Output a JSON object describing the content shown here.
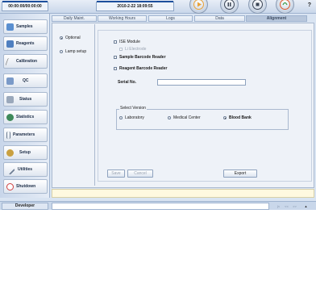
{
  "header": {
    "time_left": "00:00:00/00:00:00",
    "datetime": "2010-2-22 18:09:55",
    "help": "?"
  },
  "icons": {
    "run": "play-icon",
    "pause": "pause-icon",
    "stop": "stop-icon",
    "emergency": "emergency-icon"
  },
  "sidebar": {
    "items": [
      {
        "label": "Samples",
        "icon": "test-tube-icon",
        "color": "#5a8fd0"
      },
      {
        "label": "Reagents",
        "icon": "reagent-rack-icon",
        "color": "#4f7fc0"
      },
      {
        "label": "Calibration",
        "icon": "calibration-icon",
        "color": "#8c8c8c"
      },
      {
        "label": "QC",
        "icon": "qc-icon",
        "color": "#7a9ac8"
      },
      {
        "label": "Status",
        "icon": "status-icon",
        "color": "#9aa8bb"
      },
      {
        "label": "Statistics",
        "icon": "statistics-icon",
        "color": "#3f8a5a"
      },
      {
        "label": "Parameters",
        "icon": "parameters-icon",
        "color": "#6b7b8f"
      },
      {
        "label": "Setup",
        "icon": "setup-icon",
        "color": "#c9a040"
      },
      {
        "label": "Utilities",
        "icon": "utilities-icon",
        "color": "#6f7f95"
      },
      {
        "label": "Shutdown",
        "icon": "shutdown-icon",
        "color": "#d04040"
      }
    ]
  },
  "tabs": [
    {
      "label": "Daily Maint."
    },
    {
      "label": "Working Hours"
    },
    {
      "label": "Logs"
    },
    {
      "label": "Data"
    },
    {
      "label": "Alignment"
    }
  ],
  "left_options": {
    "optional": "Optional",
    "lamp_setup": "Lamp setup"
  },
  "options": {
    "ise_module": "ISE Module",
    "li_electrode": "Li Electrode",
    "sample_barcode": "Sample Barcode Reader",
    "reagent_barcode": "Reagent Barcode Reader",
    "serial_label": "Serial No.",
    "serial_value": ""
  },
  "version": {
    "title": "Select Version",
    "laboratory": "Laboratory",
    "medical_center": "Medical Center",
    "blood_bank": "Blood Bank"
  },
  "buttons": {
    "save": "Save",
    "cancel": "Cancel",
    "export": "Export"
  },
  "statusbar": {
    "user": "Developer"
  },
  "colors": {
    "accent": "#1d4f9c",
    "play": "#e8a23a",
    "emergency": "#e05a2a"
  }
}
